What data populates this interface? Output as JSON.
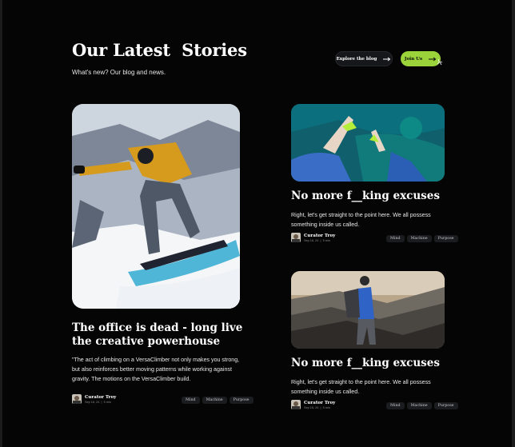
{
  "header": {
    "title": "Our Latest  Stories",
    "subtitle": "What's new?  Our blog and news.",
    "explore_label": "Explore the blog",
    "join_label": "Join Us"
  },
  "colors": {
    "accent": "#9ad43a",
    "background": "#050505",
    "chip": "#1b1c1f"
  },
  "posts": [
    {
      "title": "The office is dead - long live the creative powerhouse",
      "description": "\"The act of climbing on a VersaClimber not only makes you strong, but also reinforces better moving patterns while working against gravity. The motions on the VersaClimber build.",
      "author": "Curator Troy",
      "date": "Sep 16, 24  |  5 min",
      "tags": [
        "Mind",
        "Machine",
        "Purpose"
      ]
    },
    {
      "title": "No more f__king excuses",
      "description": "Right, let's get straight to the point here. We all possess something inside us called.",
      "author": "Curator Troy",
      "date": "Sep 16, 24  |  5 min",
      "tags": [
        "Mind",
        "Machine",
        "Purpose"
      ]
    },
    {
      "title": "No more f__king excuses",
      "description": "Right, let's get straight to the point here. We all possess something inside us called.",
      "author": "Curator Troy",
      "date": "Sep 16, 24  |  5 min",
      "tags": [
        "Mind",
        "Machine",
        "Purpose"
      ]
    }
  ]
}
